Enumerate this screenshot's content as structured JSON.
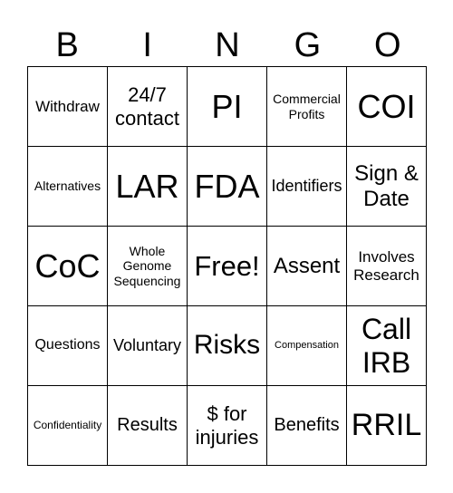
{
  "header": [
    "B",
    "I",
    "N",
    "G",
    "O"
  ],
  "cells": [
    "Withdraw",
    "24/7 contact",
    "PI",
    "Commercial Profits",
    "COI",
    "Alternatives",
    "LAR",
    "FDA",
    "Identifiers",
    "Sign & Date",
    "CoC",
    "Whole Genome Sequencing",
    "Free!",
    "Assent",
    "Involves Research",
    "Questions",
    "Voluntary",
    "Risks",
    "Compensation",
    "Call IRB",
    "Confidentiality",
    "Results",
    "$ for injuries",
    "Benefits",
    "RRIL"
  ]
}
